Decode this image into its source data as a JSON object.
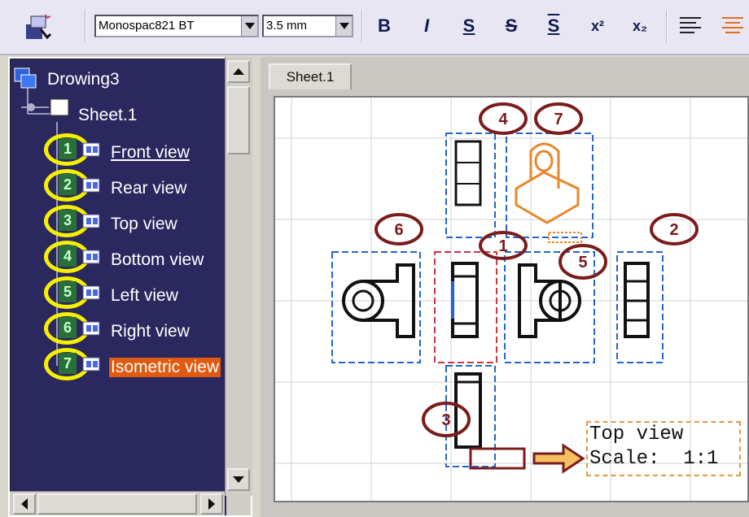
{
  "toolbar": {
    "font_name": "Monospac821 BT",
    "font_size": "3.5 mm",
    "buttons": [
      {
        "name": "bold-button",
        "glyph": "B"
      },
      {
        "name": "italic-button",
        "glyph": "I"
      },
      {
        "name": "underline-button",
        "glyph": "S"
      },
      {
        "name": "strikethrough-button",
        "glyph": "S"
      },
      {
        "name": "overline-button",
        "glyph": "S"
      },
      {
        "name": "superscript-button",
        "glyph": "x²"
      },
      {
        "name": "subscript-button",
        "glyph": "x₂"
      }
    ]
  },
  "tree": {
    "root": "Drowing3",
    "sheet": "Sheet.1",
    "views": [
      {
        "label": "Front view",
        "number": "1"
      },
      {
        "label": "Rear view",
        "number": "2"
      },
      {
        "label": "Top view",
        "number": "3"
      },
      {
        "label": "Bottom view",
        "number": "4"
      },
      {
        "label": "Left view",
        "number": "5"
      },
      {
        "label": "Right view",
        "number": "6"
      },
      {
        "label": "Isometric view",
        "number": "7"
      }
    ]
  },
  "sheet_tab": "Sheet.1",
  "callouts": [
    "4",
    "7",
    "6",
    "1",
    "5",
    "2",
    "3"
  ],
  "info_box": {
    "line1": "Top view",
    "line2": "Scale:  1:1"
  },
  "colors": {
    "tree_bg": "#2a285e",
    "highlight": "#f5f000",
    "callout": "#7a1c1c",
    "iso": "#e8872c",
    "active": "#e05a10"
  }
}
